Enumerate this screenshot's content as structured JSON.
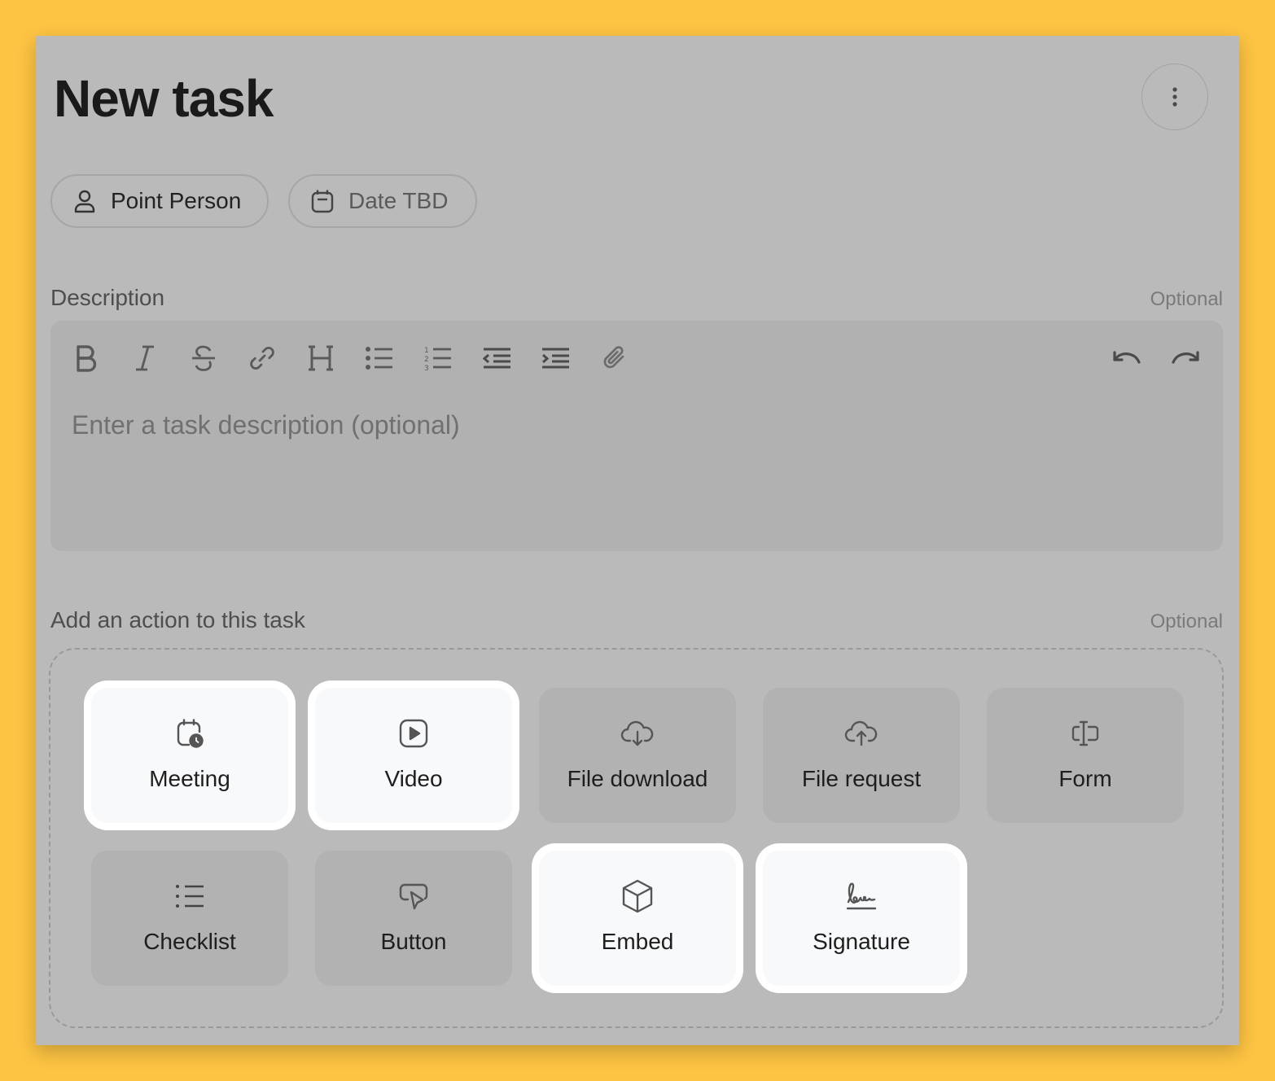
{
  "page": {
    "title": "New task"
  },
  "header": {
    "more_icon": "more-vertical-icon"
  },
  "chips": {
    "point_person": {
      "label": "Point Person",
      "icon": "user-icon"
    },
    "date": {
      "label": "Date TBD",
      "icon": "calendar-icon"
    }
  },
  "description": {
    "label": "Description",
    "optional": "Optional",
    "placeholder": "Enter a task description (optional)",
    "toolbar": [
      {
        "name": "bold",
        "icon": "bold-icon"
      },
      {
        "name": "italic",
        "icon": "italic-icon"
      },
      {
        "name": "strikethrough",
        "icon": "strikethrough-icon"
      },
      {
        "name": "link",
        "icon": "link-icon"
      },
      {
        "name": "heading",
        "icon": "heading-icon"
      },
      {
        "name": "bulleted-list",
        "icon": "bulleted-list-icon"
      },
      {
        "name": "numbered-list",
        "icon": "numbered-list-icon"
      },
      {
        "name": "outdent",
        "icon": "outdent-icon"
      },
      {
        "name": "indent",
        "icon": "indent-icon"
      },
      {
        "name": "attach",
        "icon": "paperclip-icon"
      },
      {
        "name": "undo",
        "icon": "undo-icon"
      },
      {
        "name": "redo",
        "icon": "redo-icon"
      }
    ]
  },
  "actions": {
    "label": "Add an action to this task",
    "optional": "Optional",
    "items": [
      {
        "label": "Meeting",
        "icon": "calendar-clock-icon",
        "highlighted": true
      },
      {
        "label": "Video",
        "icon": "video-play-icon",
        "highlighted": true
      },
      {
        "label": "File download",
        "icon": "cloud-download-icon",
        "highlighted": false
      },
      {
        "label": "File request",
        "icon": "cloud-upload-icon",
        "highlighted": false
      },
      {
        "label": "Form",
        "icon": "form-input-icon",
        "highlighted": false
      },
      {
        "label": "Checklist",
        "icon": "checklist-icon",
        "highlighted": false
      },
      {
        "label": "Button",
        "icon": "pointer-click-icon",
        "highlighted": false
      },
      {
        "label": "Embed",
        "icon": "cube-icon",
        "highlighted": true
      },
      {
        "label": "Signature",
        "icon": "signature-icon",
        "highlighted": true
      }
    ]
  },
  "colors": {
    "backdrop": "#FDC443",
    "overlay": "#BABABA",
    "highlight_tile": "#F8F9FB"
  }
}
